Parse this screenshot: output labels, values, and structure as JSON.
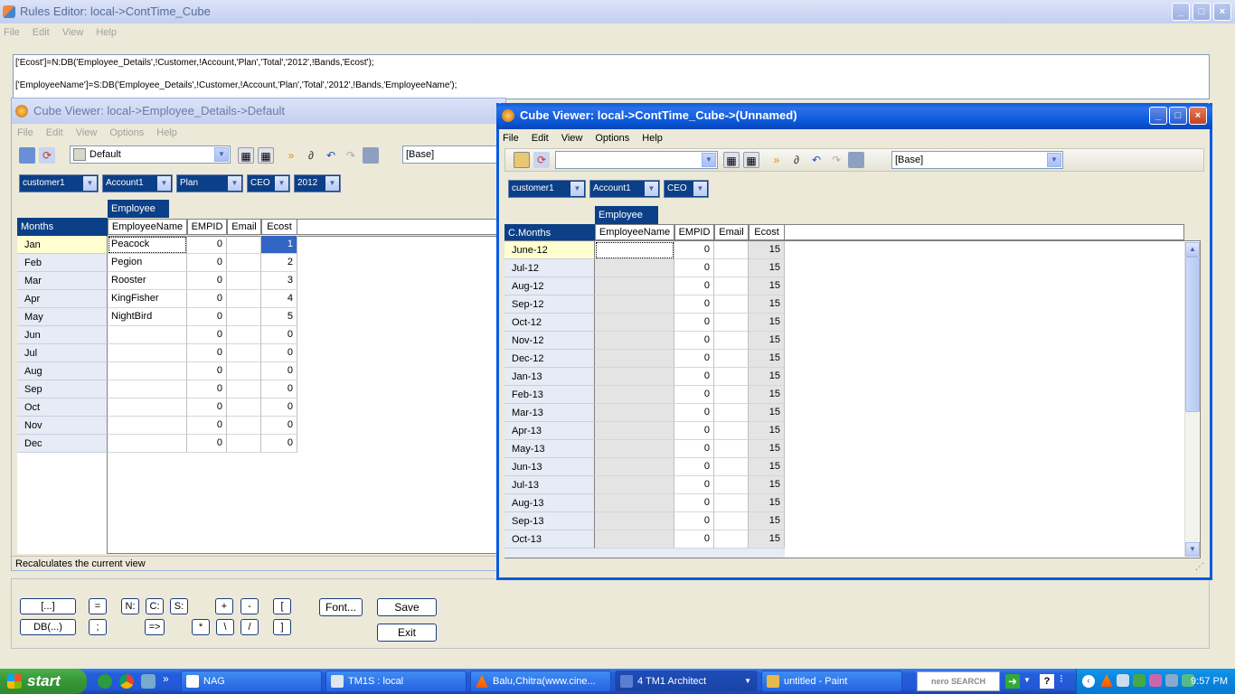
{
  "rules_editor": {
    "title": "Rules Editor:  local->ContTime_Cube",
    "menu": [
      "File",
      "Edit",
      "View",
      "Help"
    ],
    "rule_lines": [
      "['Ecost']=N:DB('Employee_Details',!Customer,!Account,'Plan','Total','2012',!Bands,'Ecost');",
      "['EmployeeName']=S:DB('Employee_Details',!Customer,!Account,'Plan','Total','2012',!Bands,'EmployeeName');"
    ],
    "buttons_left": [
      "[...]",
      "DB(...)"
    ],
    "op_row1": [
      "=",
      "N:",
      "C:",
      "S:",
      "+",
      "-",
      "["
    ],
    "op_row2": [
      ";",
      "=>",
      "*",
      "\\",
      "/",
      "]"
    ],
    "font_button": "Font...",
    "save_button": "Save",
    "exit_button": "Exit"
  },
  "viewer1": {
    "title": "Cube Viewer:  local->Employee_Details->Default",
    "menu": [
      "File",
      "Edit",
      "View",
      "Options",
      "Help"
    ],
    "view_name": "Default",
    "subset": "[Base]",
    "dims": [
      "customer1",
      "Account1",
      "Plan",
      "CEO",
      "2012"
    ],
    "column_dim": "Employee",
    "row_dim": "Months",
    "columns": [
      "EmployeeName",
      "EMPID",
      "Email",
      "Ecost"
    ],
    "rows": [
      {
        "label": "Jan",
        "name": "Peacock",
        "empid": "0",
        "email": "",
        "ecost": "1"
      },
      {
        "label": "Feb",
        "name": "Pegion",
        "empid": "0",
        "email": "",
        "ecost": "2"
      },
      {
        "label": "Mar",
        "name": "Rooster",
        "empid": "0",
        "email": "",
        "ecost": "3"
      },
      {
        "label": "Apr",
        "name": "KingFisher",
        "empid": "0",
        "email": "",
        "ecost": "4"
      },
      {
        "label": "May",
        "name": "NightBird",
        "empid": "0",
        "email": "",
        "ecost": "5"
      },
      {
        "label": "Jun",
        "name": "",
        "empid": "0",
        "email": "",
        "ecost": "0"
      },
      {
        "label": "Jul",
        "name": "",
        "empid": "0",
        "email": "",
        "ecost": "0"
      },
      {
        "label": "Aug",
        "name": "",
        "empid": "0",
        "email": "",
        "ecost": "0"
      },
      {
        "label": "Sep",
        "name": "",
        "empid": "0",
        "email": "",
        "ecost": "0"
      },
      {
        "label": "Oct",
        "name": "",
        "empid": "0",
        "email": "",
        "ecost": "0"
      },
      {
        "label": "Nov",
        "name": "",
        "empid": "0",
        "email": "",
        "ecost": "0"
      },
      {
        "label": "Dec",
        "name": "",
        "empid": "0",
        "email": "",
        "ecost": "0"
      }
    ],
    "status": "Recalculates the current view"
  },
  "viewer2": {
    "title": "Cube Viewer:  local->ContTime_Cube->(Unnamed)",
    "menu": [
      "File",
      "Edit",
      "View",
      "Options",
      "Help"
    ],
    "view_name": "",
    "subset": "[Base]",
    "dims": [
      "customer1",
      "Account1",
      "CEO"
    ],
    "column_dim": "Employee",
    "row_dim": "C.Months",
    "columns": [
      "EmployeeName",
      "EMPID",
      "Email",
      "Ecost"
    ],
    "rows": [
      {
        "label": "June-12",
        "empid": "0",
        "ecost": "15"
      },
      {
        "label": "Jul-12",
        "empid": "0",
        "ecost": "15"
      },
      {
        "label": "Aug-12",
        "empid": "0",
        "ecost": "15"
      },
      {
        "label": "Sep-12",
        "empid": "0",
        "ecost": "15"
      },
      {
        "label": "Oct-12",
        "empid": "0",
        "ecost": "15"
      },
      {
        "label": "Nov-12",
        "empid": "0",
        "ecost": "15"
      },
      {
        "label": "Dec-12",
        "empid": "0",
        "ecost": "15"
      },
      {
        "label": "Jan-13",
        "empid": "0",
        "ecost": "15"
      },
      {
        "label": "Feb-13",
        "empid": "0",
        "ecost": "15"
      },
      {
        "label": "Mar-13",
        "empid": "0",
        "ecost": "15"
      },
      {
        "label": "Apr-13",
        "empid": "0",
        "ecost": "15"
      },
      {
        "label": "May-13",
        "empid": "0",
        "ecost": "15"
      },
      {
        "label": "Jun-13",
        "empid": "0",
        "ecost": "15"
      },
      {
        "label": "Jul-13",
        "empid": "0",
        "ecost": "15"
      },
      {
        "label": "Aug-13",
        "empid": "0",
        "ecost": "15"
      },
      {
        "label": "Sep-13",
        "empid": "0",
        "ecost": "15"
      },
      {
        "label": "Oct-13",
        "empid": "0",
        "ecost": "15"
      }
    ]
  },
  "taskbar": {
    "start": "start",
    "tasks": [
      "NAG",
      "TM1S : local",
      "Balu,Chitra(www.cine...",
      "4 TM1 Architect",
      "untitled - Paint"
    ],
    "search_logo": "nero SEARCH",
    "clock": "9:57 PM"
  },
  "colors": {
    "title_active": "#0a5bde",
    "dim_header": "#0b3f87",
    "selection": "#3166c5"
  }
}
